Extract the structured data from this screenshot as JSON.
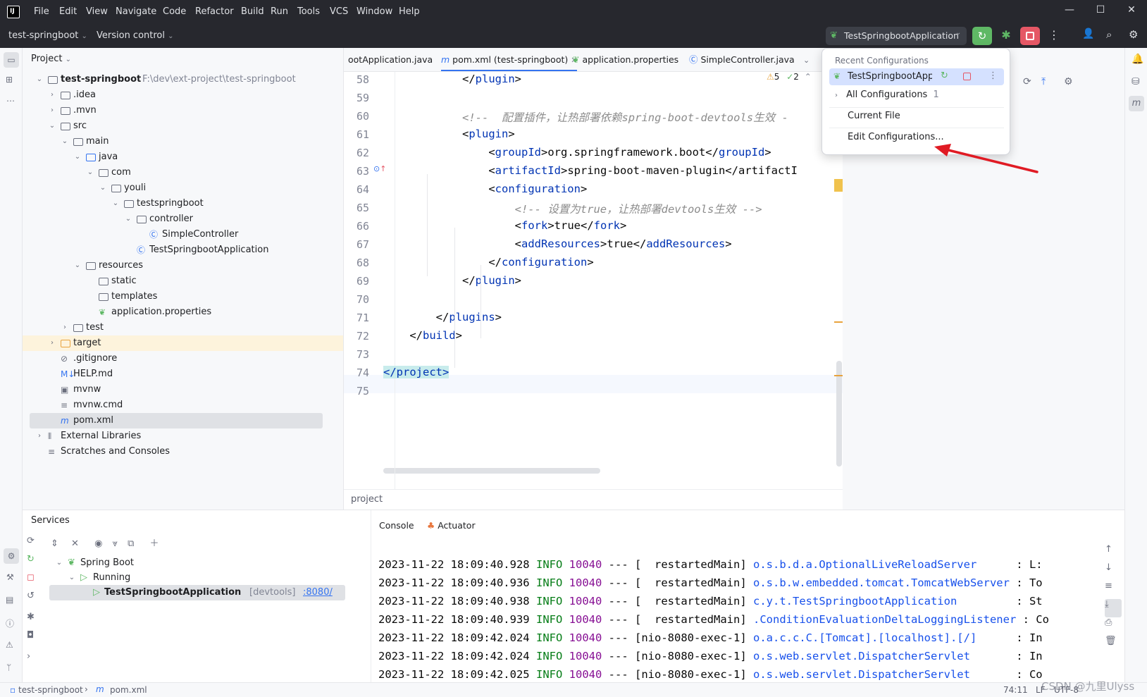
{
  "menu": [
    "File",
    "Edit",
    "View",
    "Navigate",
    "Code",
    "Refactor",
    "Build",
    "Run",
    "Tools",
    "VCS",
    "Window",
    "Help"
  ],
  "toolbar": {
    "project_name": "test-springboot",
    "vcs": "Version control",
    "run_config": "TestSpringbootApplication"
  },
  "project_panel": {
    "title": "Project",
    "tree": [
      {
        "label": "test-springboot",
        "path": "F:\\dev\\ext-project\\test-springboot"
      },
      {
        "label": ".idea"
      },
      {
        "label": ".mvn"
      },
      {
        "label": "src"
      },
      {
        "label": "main"
      },
      {
        "label": "java"
      },
      {
        "label": "com"
      },
      {
        "label": "youli"
      },
      {
        "label": "testspringboot"
      },
      {
        "label": "controller"
      },
      {
        "label": "SimpleController"
      },
      {
        "label": "TestSpringbootApplication"
      },
      {
        "label": "resources"
      },
      {
        "label": "static"
      },
      {
        "label": "templates"
      },
      {
        "label": "application.properties"
      },
      {
        "label": "test"
      },
      {
        "label": "target"
      },
      {
        "label": ".gitignore"
      },
      {
        "label": "HELP.md"
      },
      {
        "label": "mvnw"
      },
      {
        "label": "mvnw.cmd"
      },
      {
        "label": "pom.xml"
      },
      {
        "label": "External Libraries"
      },
      {
        "label": "Scratches and Consoles"
      }
    ]
  },
  "tabs": [
    {
      "label": "ootApplication.java"
    },
    {
      "label": "pom.xml (test-springboot)"
    },
    {
      "label": "application.properties"
    },
    {
      "label": "SimpleController.java"
    }
  ],
  "inspections": {
    "warnings": "5",
    "ok": "2"
  },
  "editor": {
    "lines": [
      "58",
      "59",
      "60",
      "61",
      "62",
      "63",
      "64",
      "65",
      "66",
      "67",
      "68",
      "69",
      "70",
      "71",
      "72",
      "73",
      "74",
      "75"
    ],
    "code": [
      "            </plugin>",
      "",
      "            <!--  配置插件，让热部署依赖spring-boot-devtools生效 -",
      "            <plugin>",
      "                <groupId>org.springframework.boot</groupId>",
      "                <artifactId>spring-boot-maven-plugin</artifactI",
      "                <configuration>",
      "                    <!-- 设置为true，让热部署devtools生效 -->",
      "                    <fork>true</fork>",
      "                    <addResources>true</addResources>",
      "                </configuration>",
      "            </plugin>",
      "",
      "        </plugins>",
      "    </build>",
      "",
      "</project>",
      ""
    ],
    "breadcrumb": "project"
  },
  "popup": {
    "header": "Recent Configurations",
    "selected": "TestSpringbootApp",
    "all_configs": "All Configurations",
    "all_configs_count": "1",
    "current_file": "Current File",
    "edit_configs": "Edit Configurations..."
  },
  "services": {
    "title": "Services",
    "tree": {
      "spring_boot": "Spring Boot",
      "running": "Running",
      "app": "TestSpringbootApplication",
      "devtools": "[devtools]",
      "port": ":8080/"
    },
    "tabs": [
      "Console",
      "Actuator"
    ]
  },
  "console": [
    {
      "ts": "2023-11-22 18:09:40.928",
      "level": "INFO",
      "pid": "10040",
      "sep": "---",
      "thread": "[  restartedMain]",
      "logger": "o.s.b.d.a.OptionalLiveReloadServer     ",
      "tail": ": L:"
    },
    {
      "ts": "2023-11-22 18:09:40.936",
      "level": "INFO",
      "pid": "10040",
      "sep": "---",
      "thread": "[  restartedMain]",
      "logger": "o.s.b.w.embedded.tomcat.TomcatWebServer",
      "tail": ": To"
    },
    {
      "ts": "2023-11-22 18:09:40.938",
      "level": "INFO",
      "pid": "10040",
      "sep": "---",
      "thread": "[  restartedMain]",
      "logger": "c.y.t.TestSpringbootApplication        ",
      "tail": ": St"
    },
    {
      "ts": "2023-11-22 18:09:40.939",
      "level": "INFO",
      "pid": "10040",
      "sep": "---",
      "thread": "[  restartedMain]",
      "logger": ".ConditionEvaluationDeltaLoggingListener",
      "tail": ": Co"
    },
    {
      "ts": "2023-11-22 18:09:42.024",
      "level": "INFO",
      "pid": "10040",
      "sep": "---",
      "thread": "[nio-8080-exec-1]",
      "logger": "o.a.c.c.C.[Tomcat].[localhost].[/]     ",
      "tail": ": In"
    },
    {
      "ts": "2023-11-22 18:09:42.024",
      "level": "INFO",
      "pid": "10040",
      "sep": "---",
      "thread": "[nio-8080-exec-1]",
      "logger": "o.s.web.servlet.DispatcherServlet      ",
      "tail": ": In"
    },
    {
      "ts": "2023-11-22 18:09:42.025",
      "level": "INFO",
      "pid": "10040",
      "sep": "---",
      "thread": "[nio-8080-exec-1]",
      "logger": "o.s.web.servlet.DispatcherServlet      ",
      "tail": ": Co"
    }
  ],
  "statusbar": {
    "project": "test-springboot",
    "file": "pom.xml",
    "position": "74:11",
    "lf": "LF",
    "encoding": "UTF-8",
    "watermark": "CSDN @九里Ulyss"
  },
  "colors": {
    "accent": "#3574f0",
    "run_green": "#5fb865",
    "stop_red": "#e55765",
    "selected_row": "#dfe1e5",
    "highlight_yellow": "#fdf6e3",
    "tag_blue": "#0033b3"
  }
}
